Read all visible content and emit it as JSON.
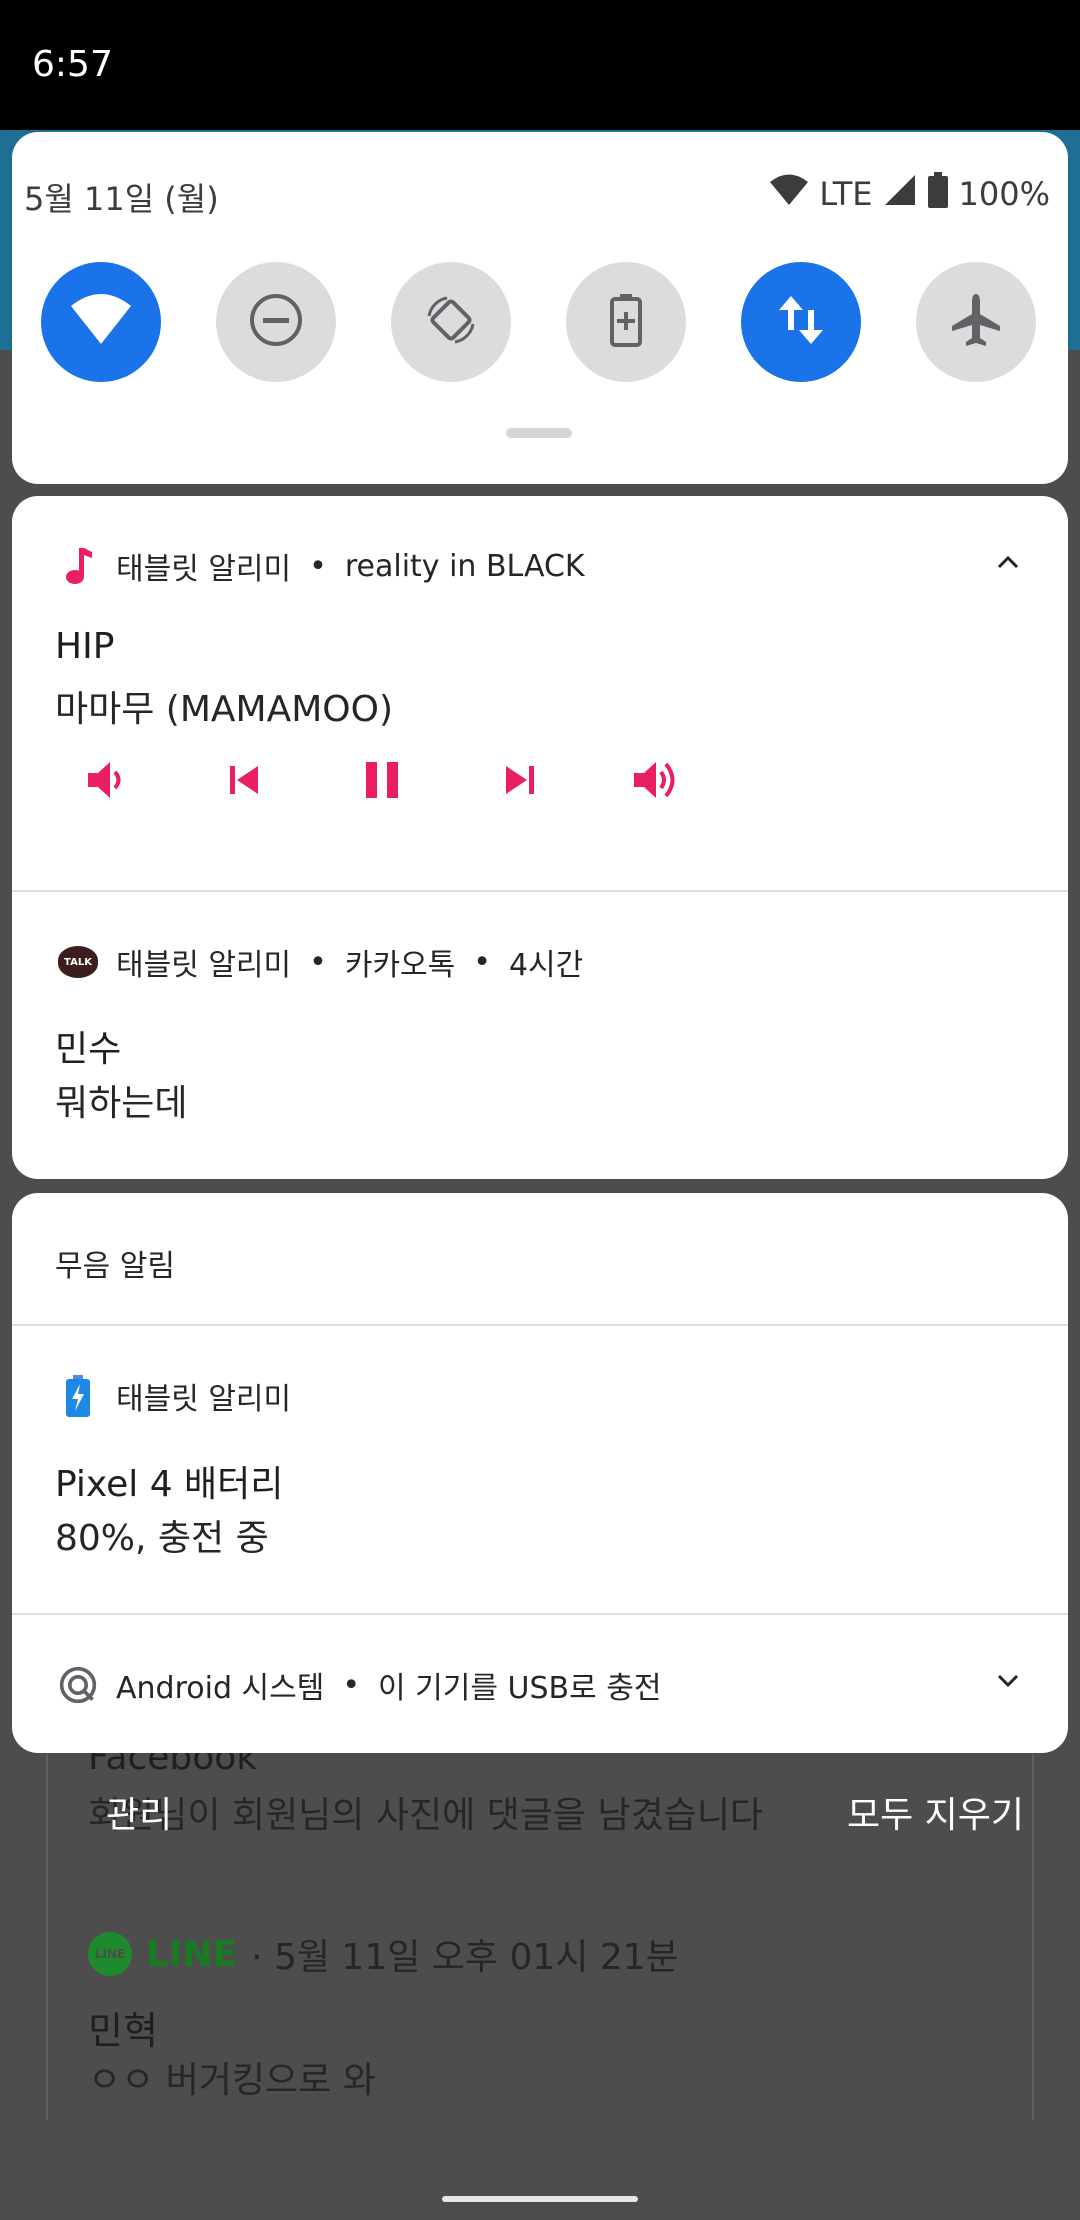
{
  "status_bar": {
    "time": "6:57"
  },
  "quick_settings": {
    "date": "5월 11일 (월)",
    "network": "LTE",
    "battery": "100%",
    "tiles": [
      {
        "name": "wifi",
        "on": true
      },
      {
        "name": "do-not-disturb",
        "on": false
      },
      {
        "name": "auto-rotate",
        "on": false
      },
      {
        "name": "battery-saver",
        "on": false
      },
      {
        "name": "mobile-data",
        "on": true
      },
      {
        "name": "airplane-mode",
        "on": false
      }
    ]
  },
  "media_notification": {
    "app": "태블릿 알리미",
    "separator": "•",
    "source": "reality in BLACK",
    "title": "HIP",
    "artist": "마마무 (MAMAMOO)",
    "controls": [
      "volume-down",
      "previous",
      "pause",
      "next",
      "volume-up"
    ],
    "accent_color": "#e91e63"
  },
  "kakao_notification": {
    "app": "태블릿 알리미",
    "source": "카카오톡",
    "time": "4시간",
    "icon_label": "TALK",
    "sender": "민수",
    "message": "뭐하는데"
  },
  "silent_section": {
    "header": "무음 알림",
    "battery_notification": {
      "app": "태블릿 알리미",
      "title": "Pixel 4 배터리",
      "text": "80%, 충전 중"
    },
    "system_notification": {
      "app": "Android 시스템",
      "text": "이 기기를 USB로 충전"
    }
  },
  "background": {
    "facebook_title": "Facebook",
    "facebook_text": "회원님이 회원님의 사진에 댓글을 남겼습니다",
    "manage_label": "관리",
    "clear_all_label": "모두 지우기",
    "line_icon_label": "LINE",
    "line_app": "LINE",
    "line_time": "· 5월 11일 오후 01시 21분",
    "line_sender": "민혁",
    "line_message": "ㅇㅇ 버거킹으로 와"
  }
}
